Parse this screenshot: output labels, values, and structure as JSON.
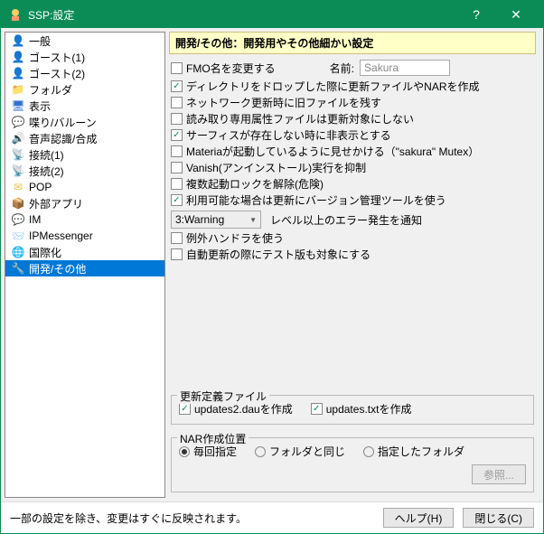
{
  "titlebar": {
    "text": "SSP:設定"
  },
  "sidebar": {
    "items": [
      {
        "label": "一般",
        "icon": "👤",
        "color": "#f0c040"
      },
      {
        "label": "ゴースト(1)",
        "icon": "👤",
        "color": "#f0c040"
      },
      {
        "label": "ゴースト(2)",
        "icon": "👤",
        "color": "#f0c040"
      },
      {
        "label": "フォルダ",
        "icon": "📁",
        "color": "#f0c040"
      },
      {
        "label": "表示",
        "icon": "🖥",
        "color": "#3070d0"
      },
      {
        "label": "喋り/バルーン",
        "icon": "💬",
        "color": "#4090e0"
      },
      {
        "label": "音声認識/合成",
        "icon": "🔊",
        "color": "#e04030"
      },
      {
        "label": "接続(1)",
        "icon": "📡",
        "color": "#e04030"
      },
      {
        "label": "接続(2)",
        "icon": "📡",
        "color": "#e04030"
      },
      {
        "label": "POP",
        "icon": "✉",
        "color": "#f0c040"
      },
      {
        "label": "外部アプリ",
        "icon": "📦",
        "color": "#d08020"
      },
      {
        "label": "IM",
        "icon": "💬",
        "color": "#50a0e0"
      },
      {
        "label": "IPMessenger",
        "icon": "📨",
        "color": "#f0c040"
      },
      {
        "label": "国際化",
        "icon": "🌐",
        "color": "#30a060"
      },
      {
        "label": "開発/その他",
        "icon": "🔧",
        "color": "#3080d0",
        "selected": true
      }
    ]
  },
  "content": {
    "header": "開発/その他：開発用やその他細かい設定",
    "fmo_row": {
      "check_label": "FMO名を変更する",
      "name_label": "名前:",
      "name_value": "Sakura"
    },
    "checks": [
      {
        "label": "ディレクトリをドロップした際に更新ファイルやNARを作成",
        "checked": true
      },
      {
        "label": "ネットワーク更新時に旧ファイルを残す",
        "checked": false
      },
      {
        "label": "読み取り専用属性ファイルは更新対象にしない",
        "checked": false
      },
      {
        "label": "サーフィスが存在しない時に非表示とする",
        "checked": true
      },
      {
        "label": "Materiaが起動しているように見せかける（\"sakura\" Mutex）",
        "checked": false
      },
      {
        "label": "Vanish(アンインストール)実行を抑制",
        "checked": false
      },
      {
        "label": "複数起動ロックを解除(危険)",
        "checked": false
      },
      {
        "label": "利用可能な場合は更新にバージョン管理ツールを使う",
        "checked": true
      }
    ],
    "level_select": {
      "value": "3:Warning",
      "label": "レベル以上のエラー発生を通知"
    },
    "checks2": [
      {
        "label": "例外ハンドラを使う",
        "checked": false
      },
      {
        "label": "自動更新の際にテスト版も対象にする",
        "checked": false
      }
    ],
    "update_fieldset": {
      "legend": "更新定義ファイル",
      "checks": [
        {
          "label": "updates2.dauを作成",
          "checked": true
        },
        {
          "label": "updates.txtを作成",
          "checked": true
        }
      ]
    },
    "nar_fieldset": {
      "legend": "NAR作成位置",
      "radios": [
        {
          "label": "毎回指定",
          "checked": true
        },
        {
          "label": "フォルダと同じ",
          "checked": false
        },
        {
          "label": "指定したフォルダ",
          "checked": false
        }
      ],
      "browse": "参照..."
    }
  },
  "bottom": {
    "note": "一部の設定を除き、変更はすぐに反映されます。",
    "help": "ヘルプ(H)",
    "close": "閉じる(C)"
  }
}
